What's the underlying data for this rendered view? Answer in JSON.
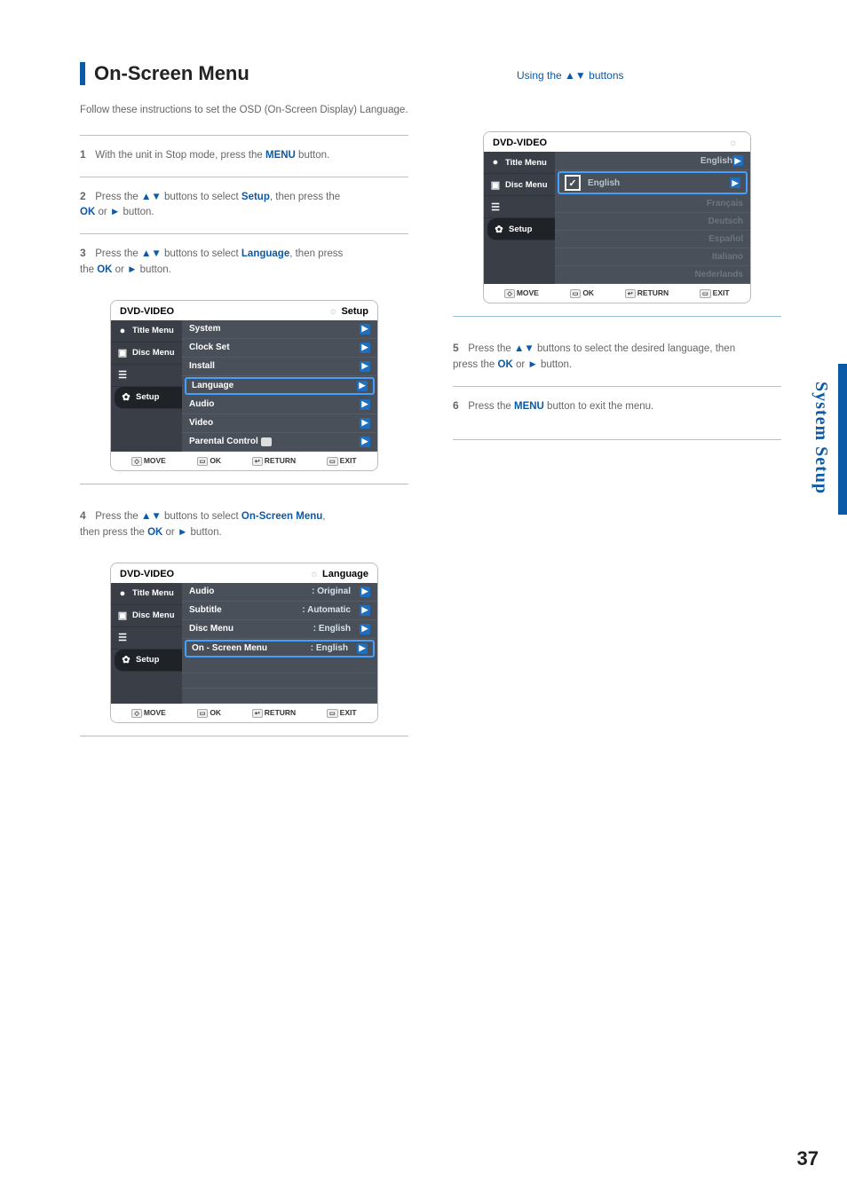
{
  "header": {
    "title": "On-Screen Menu",
    "instruction_prefix": "Using the ",
    "instruction_suffix": " buttons"
  },
  "intro": "Follow these instructions to set the OSD (On-Screen Display) Language.",
  "steps": {
    "s1": {
      "num": "1",
      "l1": "With the unit in Stop mode, press the ",
      "menu": "MENU",
      "l2": " button."
    },
    "s2": {
      "num": "2",
      "l1": "Press the ",
      "l2": " buttons to select ",
      "opt": "Setup",
      "l3": ", then press the",
      "ok": "OK",
      "l4": " or ",
      "l5": " button."
    },
    "s3": {
      "num": "3",
      "l1": "Press the ",
      "l2": " buttons to select ",
      "opt": "Language",
      "l3": ", then press",
      "l4": "the ",
      "ok": "OK",
      "l5": " or ",
      "l6": " button."
    },
    "s4": {
      "num": "4",
      "l1": "Press the ",
      "l2": " buttons to select ",
      "opt": "On-Screen Menu",
      "l3": ",",
      "l4": "then press the ",
      "ok": "OK",
      "l5": " or ",
      "l6": " button."
    },
    "s5": {
      "num": "5",
      "l1": "Press the ",
      "l2": " buttons to select the desired language, then",
      "l3": "press the ",
      "ok": "OK",
      "l4": " or ",
      "l5": " button."
    },
    "s6": {
      "num": "6",
      "l1": "Press the ",
      "menu": "MENU",
      "l2": " button to exit the menu."
    }
  },
  "osd1": {
    "title": "DVD-VIDEO",
    "crumb": "Setup",
    "side": [
      "Title Menu",
      "Disc Menu",
      "",
      "Setup"
    ],
    "rows": [
      "System",
      "Clock Set",
      "Install",
      "Language",
      "Audio",
      "Video",
      "Parental Control"
    ],
    "highlight_index": 3,
    "footer": [
      "MOVE",
      "OK",
      "RETURN",
      "EXIT"
    ]
  },
  "osd2": {
    "title": "DVD-VIDEO",
    "crumb": "Language",
    "side": [
      "Title Menu",
      "Disc Menu",
      "",
      "Setup"
    ],
    "rows": [
      {
        "k": "Audio",
        "v": ": Original"
      },
      {
        "k": "Subtitle",
        "v": ": Automatic"
      },
      {
        "k": "Disc Menu",
        "v": ": English"
      },
      {
        "k": "On - Screen Menu",
        "v": ": English"
      }
    ],
    "highlight_index": 3,
    "footer": [
      "MOVE",
      "OK",
      "RETURN",
      "EXIT"
    ]
  },
  "osd3": {
    "title": "DVD-VIDEO",
    "side": [
      "Title Menu",
      "Disc Menu",
      "",
      "Setup"
    ],
    "options": [
      "English",
      "Français",
      "Deutsch",
      "Español",
      "Italiano",
      "Nederlands"
    ],
    "selected_index": 0,
    "footer": [
      "MOVE",
      "OK",
      "RETURN",
      "EXIT"
    ]
  },
  "sidebar_label": "System Setup",
  "page_number": "37",
  "icons": {
    "up": "▲",
    "down": "▼",
    "right": "►",
    "right_small": "▶",
    "gear": "☼",
    "check": "✓",
    "dot": "●"
  }
}
